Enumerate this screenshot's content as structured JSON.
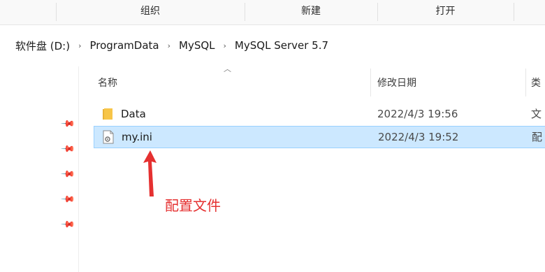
{
  "ribbon": {
    "groups": [
      {
        "label": "组织"
      },
      {
        "label": "新建"
      },
      {
        "label": "打开"
      }
    ]
  },
  "breadcrumb": {
    "segments": [
      "软件盘 (D:)",
      "ProgramData",
      "MySQL",
      "MySQL Server 5.7"
    ],
    "separator": "›"
  },
  "columns": {
    "name": "名称",
    "date_modified": "修改日期",
    "type_partial": "类"
  },
  "files": [
    {
      "name": "Data",
      "date": "2022/4/3 19:56",
      "type_partial": "文",
      "icon": "folder-icon",
      "selected": false
    },
    {
      "name": "my.ini",
      "date": "2022/4/3 19:52",
      "type_partial": "配",
      "icon": "config-file-icon",
      "selected": true
    }
  ],
  "annotation": {
    "text": "配置文件",
    "color": "#e53030"
  },
  "colors": {
    "selection_bg": "#cce8ff",
    "selection_border": "#99d1ff",
    "folder": "#f7c548"
  }
}
